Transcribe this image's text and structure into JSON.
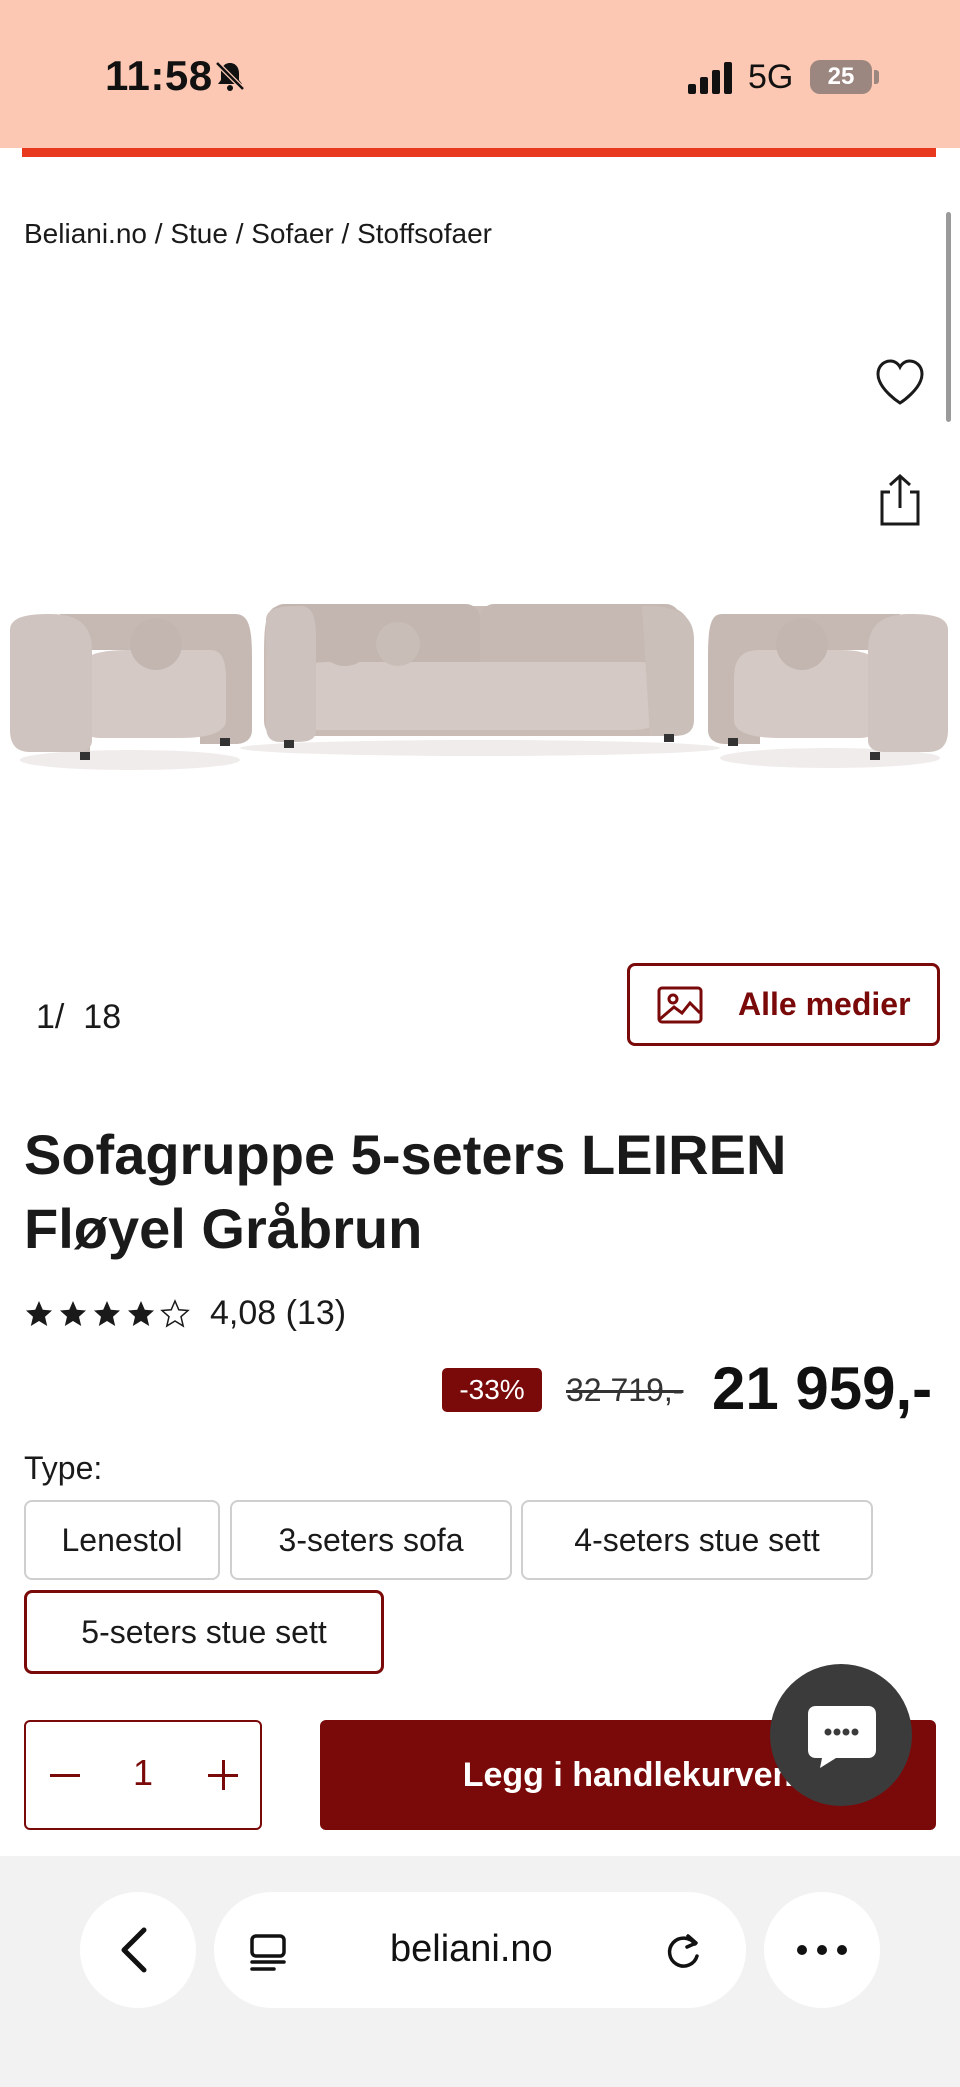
{
  "status_bar": {
    "time": "11:58",
    "network": "5G",
    "battery": "25"
  },
  "breadcrumb": "Beliani.no / Stue / Sofaer / Stoffsofaer",
  "gallery": {
    "index": "1",
    "separator": "/",
    "total": "18",
    "all_media_label": "Alle medier"
  },
  "product": {
    "title": "Sofagruppe 5-seters LEIREN Fløyel Gråbrun",
    "rating_value": 4.08,
    "rating_text": "4,08 (13)",
    "discount": "-33%",
    "old_price": "32 719,-",
    "price": "21 959,-"
  },
  "type_selector": {
    "label": "Type:",
    "options": [
      {
        "label": "Lenestol",
        "selected": false
      },
      {
        "label": "3-seters sofa",
        "selected": false
      },
      {
        "label": "4-seters stue sett",
        "selected": false
      },
      {
        "label": "5-seters stue sett",
        "selected": true
      }
    ]
  },
  "purchase": {
    "quantity": "1",
    "add_to_cart_label": "Legg i handlekurven"
  },
  "browser": {
    "url": "beliani.no"
  },
  "colors": {
    "accent": "#7a0a0a",
    "status_bar_bg": "#fcc8b3",
    "top_accent_bar": "#e8391f"
  }
}
